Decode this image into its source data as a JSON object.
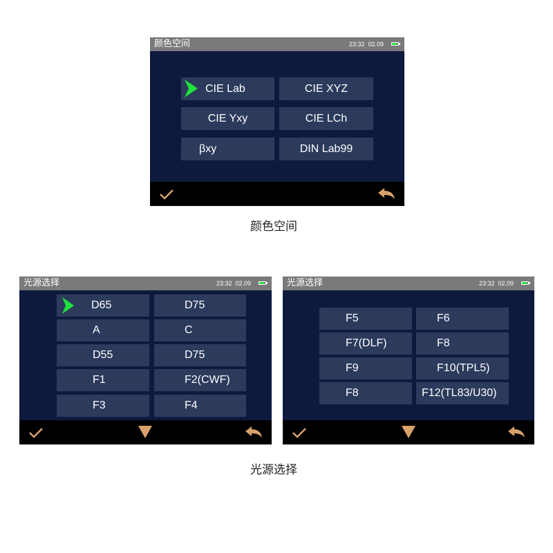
{
  "screen1": {
    "title": "颜色空间",
    "status_time": "23:32  02.09",
    "options": [
      "CIE Lab",
      "CIE XYZ",
      "CIE Yxy",
      "CIE LCh",
      "βxy",
      "DIN Lab99"
    ],
    "caption": "颜色空间"
  },
  "screen2": {
    "title": "光源选择",
    "status_time": "23:32  02.09",
    "options": [
      "D65",
      "D75",
      "A",
      "C",
      "D55",
      "D75",
      "F1",
      "F2(CWF)",
      "F3",
      "F4"
    ]
  },
  "screen3": {
    "title": "光源选择",
    "status_time": "23:32  02.09",
    "options": [
      "F5",
      "F6",
      "F7(DLF)",
      "F8",
      "F9",
      "F10(TPL5)",
      "F8",
      "F12(TL83/U30)"
    ]
  },
  "caption2": "光源选择",
  "icons": {
    "confirm": "checkmark-icon",
    "down": "down-triangle-icon",
    "back": "back-arrow-icon",
    "selected": "selection-arrow-icon",
    "battery": "battery-icon"
  },
  "colors": {
    "screen_bg": "#0d1a3d",
    "button_bg": "#2c3a5c",
    "titlebar_bg": "#7a7a7c",
    "accent_icon": "#d9a16a",
    "selection_arrow": "#1fe23d"
  }
}
